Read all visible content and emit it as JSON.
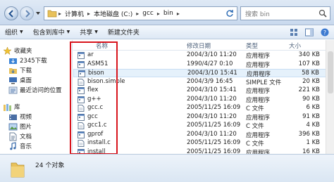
{
  "address": {
    "crumbs": [
      "计算机",
      "本地磁盘 (C:)",
      "gcc",
      "bin"
    ],
    "search_placeholder": "搜索 bin"
  },
  "toolbar": {
    "organize": "组织",
    "include": "包含到库中",
    "share": "共享",
    "new_folder": "新建文件夹"
  },
  "sidebar": {
    "favorites_label": "收藏夹",
    "favorites": [
      "2345下载",
      "下载",
      "桌面",
      "最近访问的位置"
    ],
    "library_label": "库",
    "libraries": [
      "视频",
      "图片",
      "文档",
      "音乐"
    ]
  },
  "columns": {
    "name": "名称",
    "date": "修改日期",
    "type": "类型",
    "size": "大小"
  },
  "files": [
    {
      "name": "ar",
      "date": "2004/3/10 11:20",
      "type": "应用程序",
      "size": "340 KB"
    },
    {
      "name": "ASM51",
      "date": "1990/4/27 0:10",
      "type": "应用程序",
      "size": "107 KB"
    },
    {
      "name": "bison",
      "date": "2004/3/10 15:41",
      "type": "应用程序",
      "size": "58 KB"
    },
    {
      "name": "bison.simple",
      "date": "2004/3/9 16:45",
      "type": "SIMPLE 文件",
      "size": "20 KB"
    },
    {
      "name": "flex",
      "date": "2004/3/10 15:41",
      "type": "应用程序",
      "size": "221 KB"
    },
    {
      "name": "g++",
      "date": "2004/3/10 11:20",
      "type": "应用程序",
      "size": "90 KB"
    },
    {
      "name": "gcc.c",
      "date": "2005/11/25 16:09",
      "type": "C 文件",
      "size": "6 KB"
    },
    {
      "name": "gcc",
      "date": "2004/3/10 11:20",
      "type": "应用程序",
      "size": "91 KB"
    },
    {
      "name": "gcc1.c",
      "date": "2005/11/25 16:09",
      "type": "C 文件",
      "size": "4 KB"
    },
    {
      "name": "gprof",
      "date": "2004/3/10 11:20",
      "type": "应用程序",
      "size": "396 KB"
    },
    {
      "name": "install.c",
      "date": "2005/11/25 16:09",
      "type": "C 文件",
      "size": "1 KB"
    },
    {
      "name": "install",
      "date": "2005/11/25 16:09",
      "type": "应用程序",
      "size": "16 KB"
    }
  ],
  "status": {
    "count": "24 个对象"
  },
  "colors": {
    "highlight_border": "#d8141c",
    "selected_row": "#e5f1fb"
  }
}
